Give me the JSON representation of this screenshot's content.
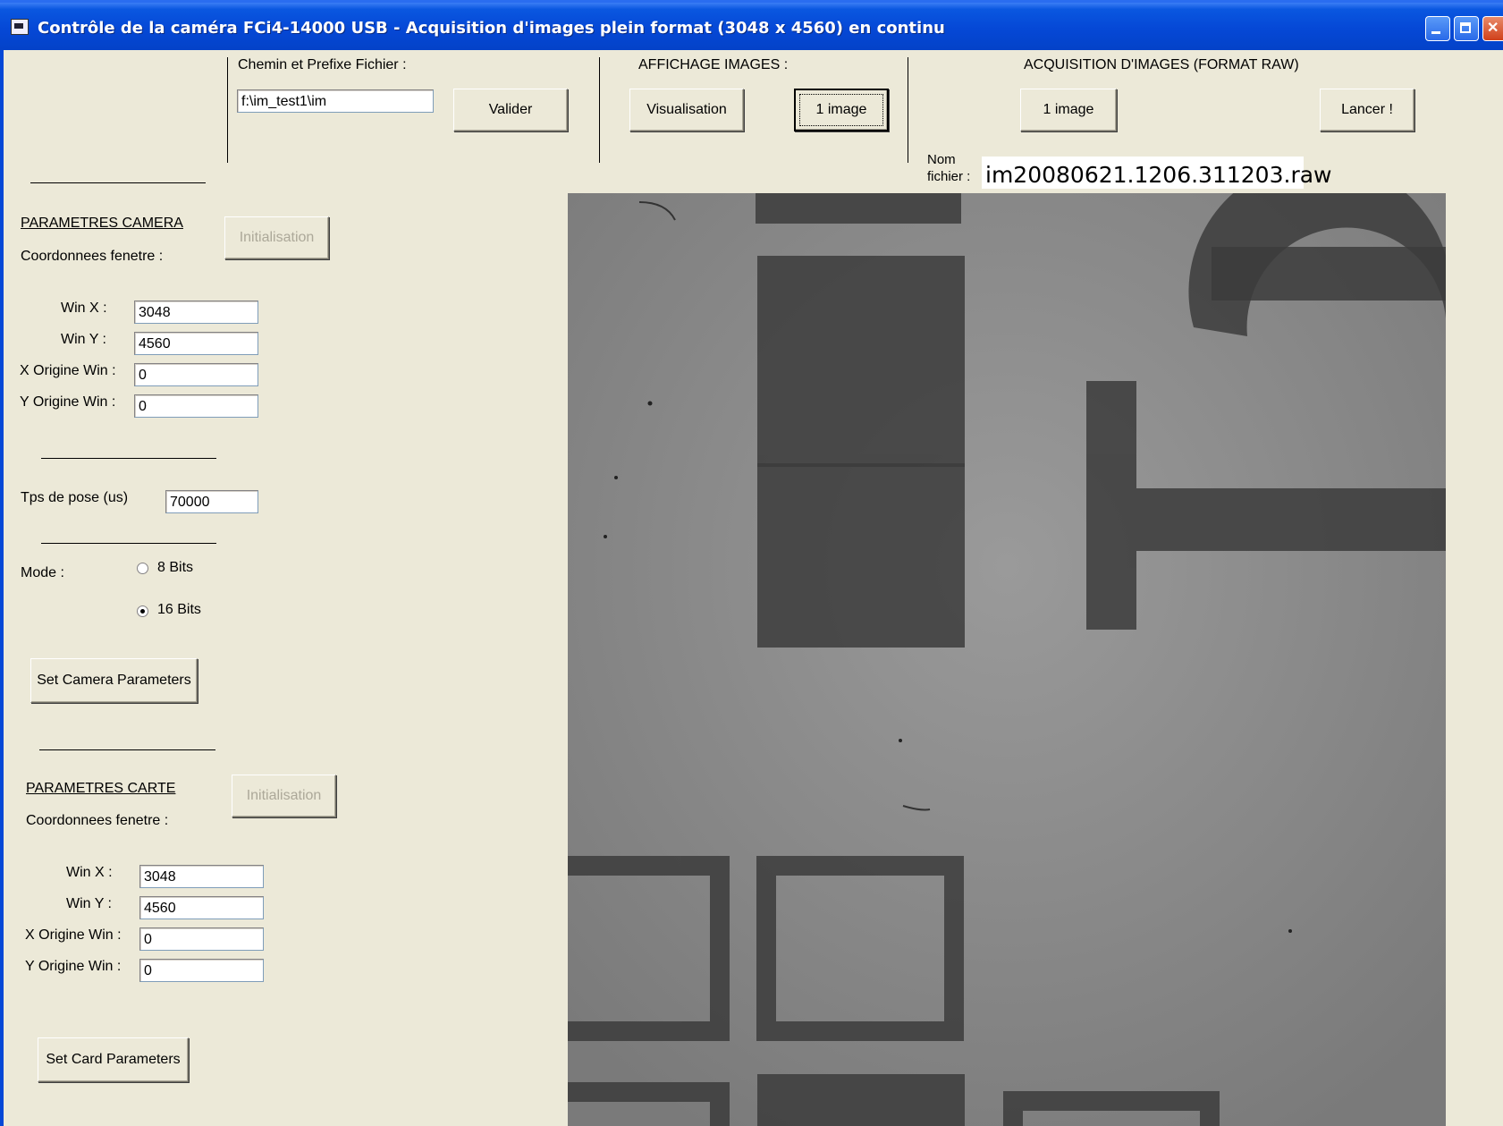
{
  "window": {
    "title": "Contrôle de la caméra FCi4-14000 USB - Acquisition d'images plein format (3048 x 4560) en continu"
  },
  "file_prefix": {
    "label": "Chemin et Prefixe Fichier :",
    "value": "f:\\im_test1\\im",
    "validate_label": "Valider"
  },
  "display": {
    "label": "AFFICHAGE IMAGES :",
    "visualisation_label": "Visualisation",
    "one_image_label": "1 image"
  },
  "acquisition": {
    "label": "ACQUISITION D'IMAGES  (FORMAT RAW)",
    "one_image_label": "1 image",
    "launch_label": "Lancer !",
    "filename_label_1": "Nom",
    "filename_label_2": "fichier :",
    "filename_value": "im20080621.1206.311203.raw"
  },
  "camera": {
    "heading": "PARAMETRES CAMERA",
    "init_label": "Initialisation",
    "coords_label": "Coordonnees fenetre :",
    "winx_label": "Win X :",
    "winx_value": "3048",
    "winy_label": "Win Y :",
    "winy_value": "4560",
    "xorig_label": "X Origine Win :",
    "xorig_value": "0",
    "yorig_label": "Y Origine Win :",
    "yorig_value": "0",
    "exposure_label": "Tps de pose (us)",
    "exposure_value": "70000",
    "mode_label": "Mode :",
    "mode_8_label": "8 Bits",
    "mode_16_label": "16 Bits",
    "mode_selected": "16 Bits",
    "set_label": "Set Camera Parameters"
  },
  "card": {
    "heading": "PARAMETRES CARTE",
    "init_label": "Initialisation",
    "coords_label": "Coordonnees fenetre :",
    "winx_label": "Win X :",
    "winx_value": "3048",
    "winy_label": "Win Y :",
    "winy_value": "4560",
    "xorig_label": "X Origine Win :",
    "xorig_value": "0",
    "yorig_label": "Y Origine Win :",
    "yorig_value": "0",
    "set_label": "Set Card Parameters"
  },
  "colors": {
    "titlebar": "#0548d6",
    "window_bg": "#ece9d8",
    "preview_bg": "#8a8a8a",
    "preview_marks": "#3a3a3a"
  }
}
